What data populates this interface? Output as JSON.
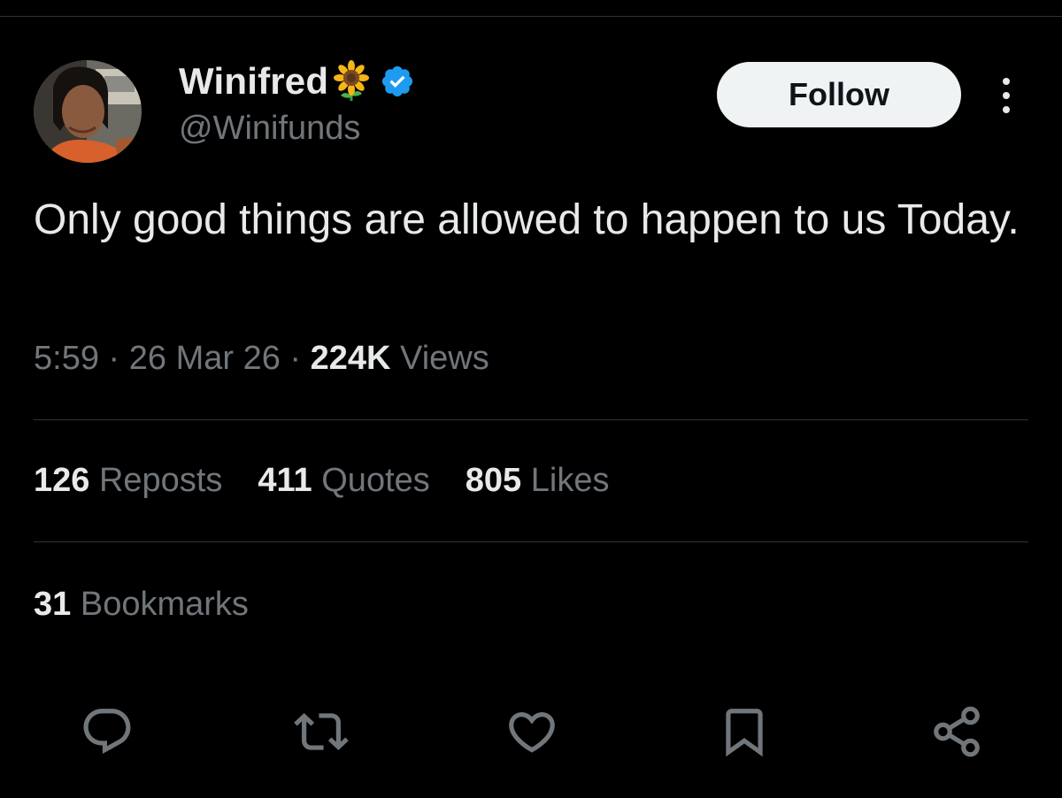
{
  "author": {
    "display_name": "Winifred",
    "name_emoji": "sunflower-icon",
    "verified": true,
    "handle": "@Winifunds"
  },
  "header": {
    "follow_label": "Follow"
  },
  "tweet": {
    "text": "Only good things are allowed to happen to us Today.",
    "time": "5:59",
    "date": "26 Mar 26",
    "views_count": "224K",
    "views_label": "Views"
  },
  "stats": {
    "reposts": {
      "count": "126",
      "label": "Reposts"
    },
    "quotes": {
      "count": "411",
      "label": "Quotes"
    },
    "likes": {
      "count": "805",
      "label": "Likes"
    },
    "bookmarks": {
      "count": "31",
      "label": "Bookmarks"
    }
  },
  "actions": [
    "reply-icon",
    "repost-icon",
    "like-icon",
    "bookmark-icon",
    "share-icon"
  ],
  "colors": {
    "background": "#000000",
    "text_primary": "#e7e9ea",
    "text_secondary": "#71767b",
    "divider": "#2f3336",
    "verified_blue": "#1d9bf0",
    "follow_bg": "#eff3f4"
  }
}
